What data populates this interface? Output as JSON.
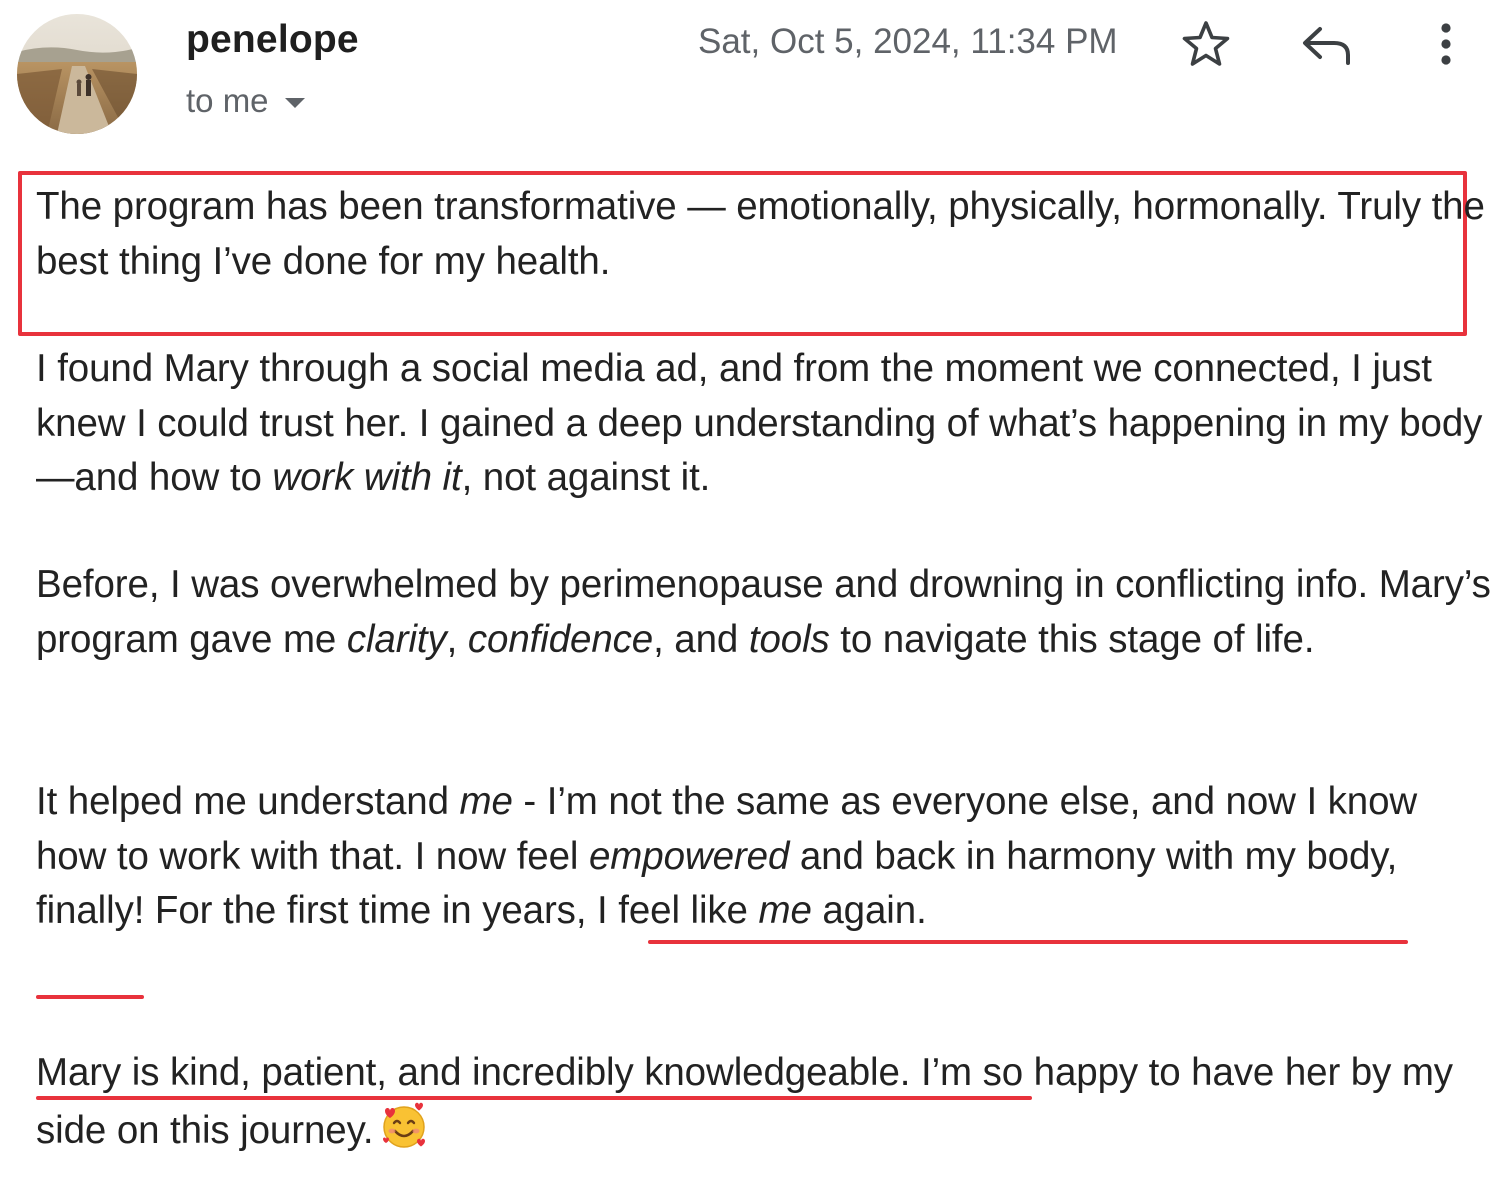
{
  "header": {
    "sender_name": "penelope",
    "recipient_label": "to me",
    "date": "Sat, Oct 5, 2024, 11:34 PM",
    "icons": {
      "avatar": "profile-photo",
      "star": "star-icon",
      "reply": "reply-icon",
      "more": "more-vertical-icon",
      "recipients_dropdown": "caret-down-icon"
    }
  },
  "message": {
    "p1": "The program has been transformative — emotionally, physically, hormonally. Truly the best thing I’ve done for my health.",
    "p2_a": "I found Mary through a social media ad, and from the moment we connected, I just knew I could trust her. I gained a deep understanding of what’s happening in my body—and how to ",
    "p2_em": "work with it",
    "p2_b": ", not against it.",
    "p3_a": "Before, I was overwhelmed by perimenopause and drowning in conflicting info. Mary’s program gave me ",
    "p3_em1": "clarity",
    "p3_b": ", ",
    "p3_em2": "confidence",
    "p3_c": ", and ",
    "p3_em3": "tools",
    "p3_d": " to navigate this stage of life.",
    "p4_a": "It helped me understand ",
    "p4_em1": "me",
    "p4_b": " - I’m not the same as everyone else, and now I know how to work with that. I now feel ",
    "p4_em2": "empowered",
    "p4_c": " and back in harmony with my body, finally! For the first time in years, I feel like ",
    "p4_em3": "me",
    "p4_d": " again.",
    "p5": "Mary is kind, patient, and incredibly knowledgeable. I’m so happy to have her by my side on this journey.",
    "p5_emoji": "smiling-face-with-hearts-emoji"
  },
  "annotations": {
    "color": "#e8323c",
    "box": "highlight-rectangle",
    "underlines": [
      "first-time-underline",
      "again-underline",
      "kind-patient-underline"
    ]
  }
}
